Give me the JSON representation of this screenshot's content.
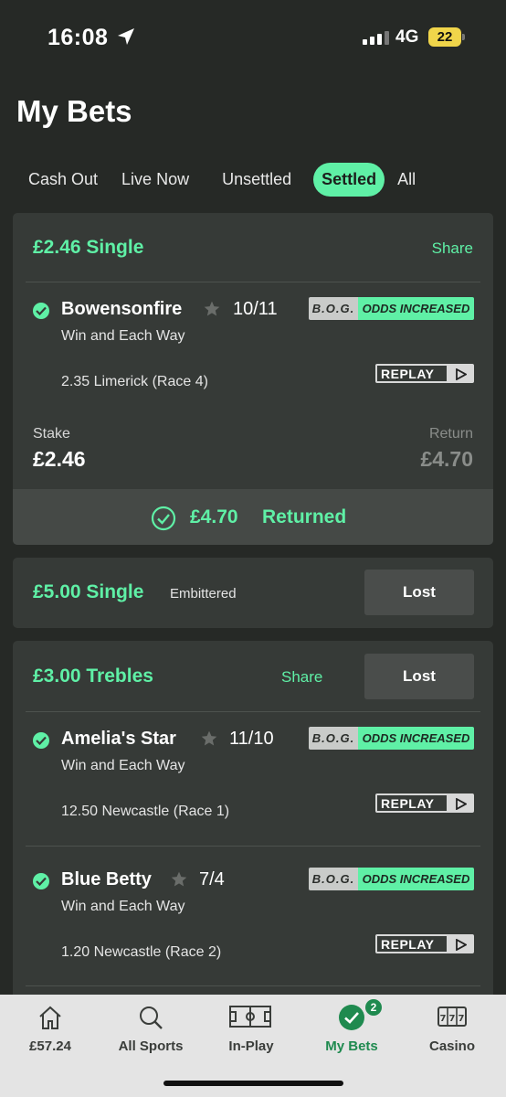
{
  "status_bar": {
    "time": "16:08",
    "network": "4G",
    "battery": "22"
  },
  "page_title": "My Bets",
  "tabs": [
    {
      "label": "Cash Out"
    },
    {
      "label": "Live Now"
    },
    {
      "label": "Unsettled"
    },
    {
      "label": "Settled",
      "active": true
    },
    {
      "label": "All"
    }
  ],
  "bet1": {
    "title": "£2.46 Single",
    "share": "Share",
    "selection": {
      "horse": "Bowensonfire",
      "odds": "10/11",
      "bog": "B.O.G.",
      "odds_increased": "ODDS INCREASED",
      "market": "Win and Each Way",
      "race": "2.35 Limerick (Race 4)",
      "replay": "REPLAY"
    },
    "stake_label": "Stake",
    "stake_value": "£2.46",
    "return_label": "Return",
    "return_value": "£4.70",
    "returned_amount": "£4.70",
    "returned_label": "Returned"
  },
  "bet2": {
    "title": "£5.00 Single",
    "horse": "Embittered",
    "result": "Lost"
  },
  "bet3": {
    "title": "£3.00 Trebles",
    "share": "Share",
    "result": "Lost",
    "selections": [
      {
        "horse": "Amelia's Star",
        "odds": "11/10",
        "bog": "B.O.G.",
        "odds_increased": "ODDS INCREASED",
        "market": "Win and Each Way",
        "race": "12.50 Newcastle (Race 1)",
        "replay": "REPLAY"
      },
      {
        "horse": "Blue Betty",
        "odds": "7/4",
        "bog": "B.O.G.",
        "odds_increased": "ODDS INCREASED",
        "market": "Win and Each Way",
        "race": "1.20 Newcastle (Race 2)",
        "replay": "REPLAY"
      }
    ]
  },
  "bottom_nav": {
    "items": [
      {
        "label": "£57.24",
        "icon": "home-icon"
      },
      {
        "label": "All Sports",
        "icon": "search-icon"
      },
      {
        "label": "In-Play",
        "icon": "pitch-icon"
      },
      {
        "label": "My Bets",
        "icon": "check-circle-icon",
        "badge": "2",
        "active": true
      },
      {
        "label": "Casino",
        "icon": "slot-machine-icon"
      }
    ]
  },
  "colors": {
    "accent": "#5ff0a6",
    "background": "#262926",
    "card": "#363a37",
    "nav_active": "#1f8a4f"
  }
}
